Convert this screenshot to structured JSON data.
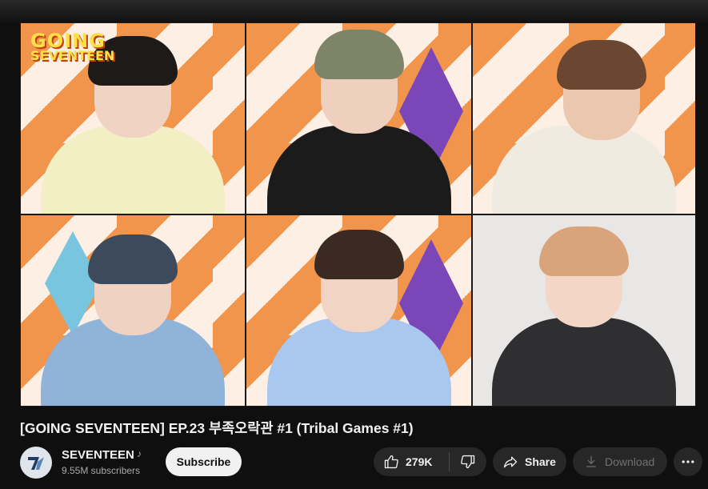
{
  "video": {
    "logo_line1": "GOING",
    "logo_line2": "SEVENTEEN",
    "title": "[GOING SEVENTEEN] EP.23 부족오락관 #1 (Tribal Games #1)"
  },
  "channel": {
    "name": "SEVENTEEN",
    "subscribers": "9.55M subscribers",
    "badge_icon": "music-note-icon"
  },
  "actions": {
    "subscribe_label": "Subscribe",
    "like_count": "279K",
    "share_label": "Share",
    "download_label": "Download"
  },
  "colors": {
    "background": "#0f0f0f",
    "pill": "#272727",
    "subscribe_bg": "#f1f1f1",
    "logo_yellow": "#fde047",
    "studio_orange": "#f2954c",
    "studio_purple": "#7b47b8",
    "studio_blue": "#79c4de"
  }
}
